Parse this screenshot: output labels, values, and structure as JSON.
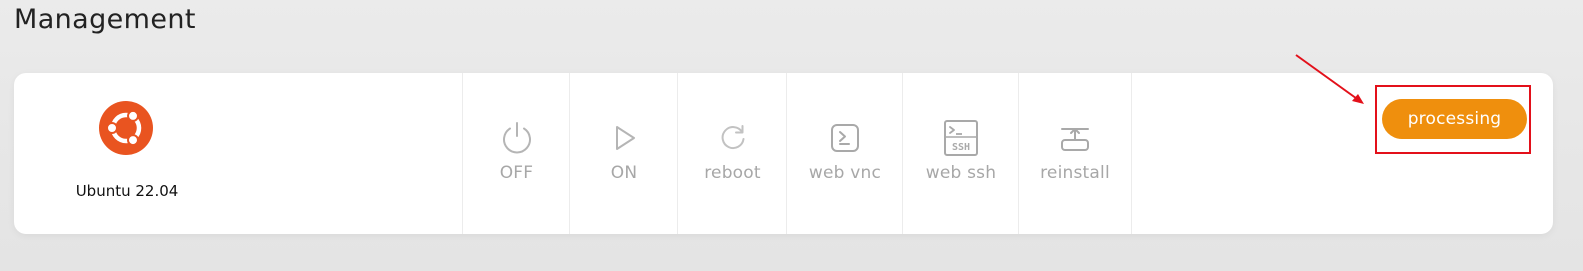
{
  "page": {
    "title": "Management"
  },
  "server": {
    "os_name": "Ubuntu 22.04",
    "os_logo_icon": "ubuntu-logo-icon",
    "os_brand_color": "#e95420"
  },
  "actions": [
    {
      "label": "OFF",
      "icon": "power-icon"
    },
    {
      "label": "ON",
      "icon": "play-icon"
    },
    {
      "label": "reboot",
      "icon": "reboot-icon"
    },
    {
      "label": "web vnc",
      "icon": "terminal-icon"
    },
    {
      "label": "web ssh",
      "icon": "ssh-icon"
    },
    {
      "label": "reinstall",
      "icon": "reinstall-icon"
    }
  ],
  "status": {
    "label": "processing",
    "color": "#ef8f0d"
  },
  "annotation": {
    "color": "#e3101a"
  }
}
